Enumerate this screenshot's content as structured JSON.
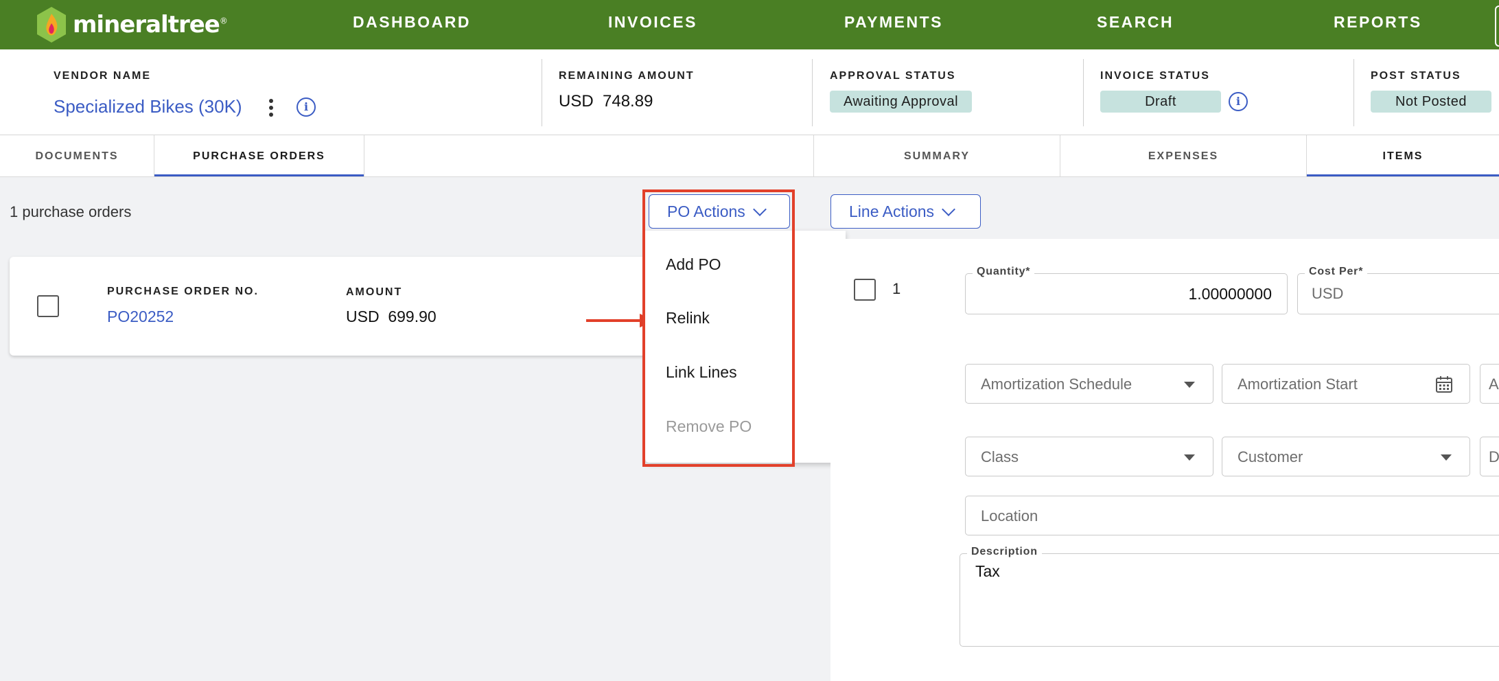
{
  "nav": {
    "logo_text": "mineraltree",
    "logo_mark": "®",
    "items": [
      "DASHBOARD",
      "INVOICES",
      "PAYMENTS",
      "SEARCH",
      "REPORTS"
    ]
  },
  "header": {
    "vendor_label": "VENDOR NAME",
    "vendor_name": "Specialized Bikes (30K)",
    "remaining_label": "REMAINING AMOUNT",
    "remaining_currency": "USD",
    "remaining_value": "748.89",
    "approval_label": "APPROVAL STATUS",
    "approval_value": "Awaiting Approval",
    "invoice_status_label": "INVOICE STATUS",
    "invoice_status_value": "Draft",
    "post_status_label": "POST STATUS",
    "post_status_value": "Not Posted",
    "status_color": "#c6e2de"
  },
  "tabs_left": [
    "DOCUMENTS",
    "PURCHASE ORDERS"
  ],
  "tabs_right": [
    "SUMMARY",
    "EXPENSES",
    "ITEMS"
  ],
  "left": {
    "count_text": "1 purchase orders",
    "po_actions_label": "PO Actions",
    "table_headers": [
      "PURCHASE ORDER NO.",
      "AMOUNT"
    ],
    "rows": [
      {
        "po_number": "PO20252",
        "currency": "USD",
        "amount": "699.90"
      }
    ],
    "menu": [
      "Add PO",
      "Relink",
      "Link Lines",
      "Remove PO"
    ]
  },
  "right": {
    "line_actions_label": "Line Actions",
    "line_number": "1",
    "quantity_label": "Quantity*",
    "quantity_value": "1.00000000",
    "cost_label": "Cost Per*",
    "cost_currency": "USD",
    "amortization_schedule": "Amortization Schedule",
    "amortization_start": "Amortization Start",
    "amortization_end_partial": "A",
    "class_placeholder": "Class",
    "customer_placeholder": "Customer",
    "partial_placeholder": "D",
    "location_placeholder": "Location",
    "description_label": "Description",
    "description_value": "Tax"
  },
  "colors": {
    "nav_bg": "#4a7f24",
    "accent": "#3b5cc4",
    "highlight": "#e2402a"
  }
}
